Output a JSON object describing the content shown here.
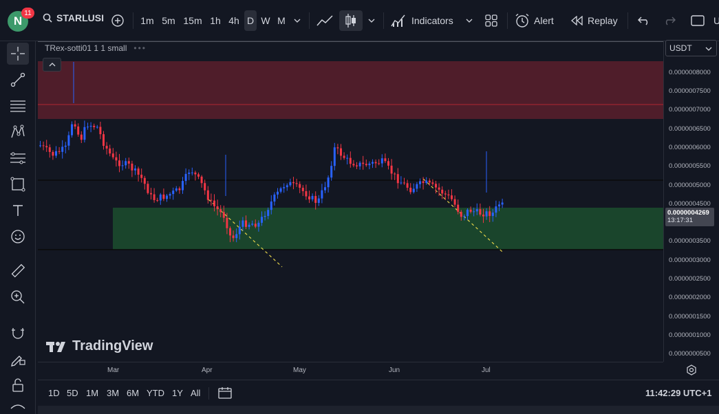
{
  "header": {
    "avatar_letter": "N",
    "notification_count": "11",
    "symbol": "STARLUSI",
    "intervals": [
      "1m",
      "5m",
      "15m",
      "1h",
      "4h",
      "D",
      "W",
      "M"
    ],
    "active_interval": "D",
    "indicators_label": "Indicators",
    "alert_label": "Alert",
    "replay_label": "Replay",
    "right_cut_label": "U"
  },
  "chart": {
    "legend_title": "TRex-sotti01 1 1 small",
    "currency": "USDT",
    "current_price": "0.0000004269",
    "countdown": "13:17:31",
    "watermark": "TradingView",
    "price_labels": [
      "0.0000008000",
      "0.0000007500",
      "0.0000007000",
      "0.0000006500",
      "0.0000006000",
      "0.0000005500",
      "0.0000005000",
      "0.0000004500",
      "0.0000003500",
      "0.0000003000",
      "0.0000002500",
      "0.0000002000",
      "0.0000001500",
      "0.0000001000",
      "0.0000000500"
    ],
    "time_labels": [
      "Mar",
      "Apr",
      "May",
      "Jun",
      "Jul"
    ],
    "colors": {
      "up": "#2962ff",
      "down": "#f23645",
      "supply_zone": "#5b1f2c",
      "demand_zone": "#1c4a2e",
      "background": "#131722",
      "trendline": "#e6d34a"
    }
  },
  "bottom": {
    "ranges": [
      "1D",
      "5D",
      "1M",
      "3M",
      "6M",
      "YTD",
      "1Y",
      "All"
    ],
    "clock": "11:42:29 UTC+1"
  }
}
